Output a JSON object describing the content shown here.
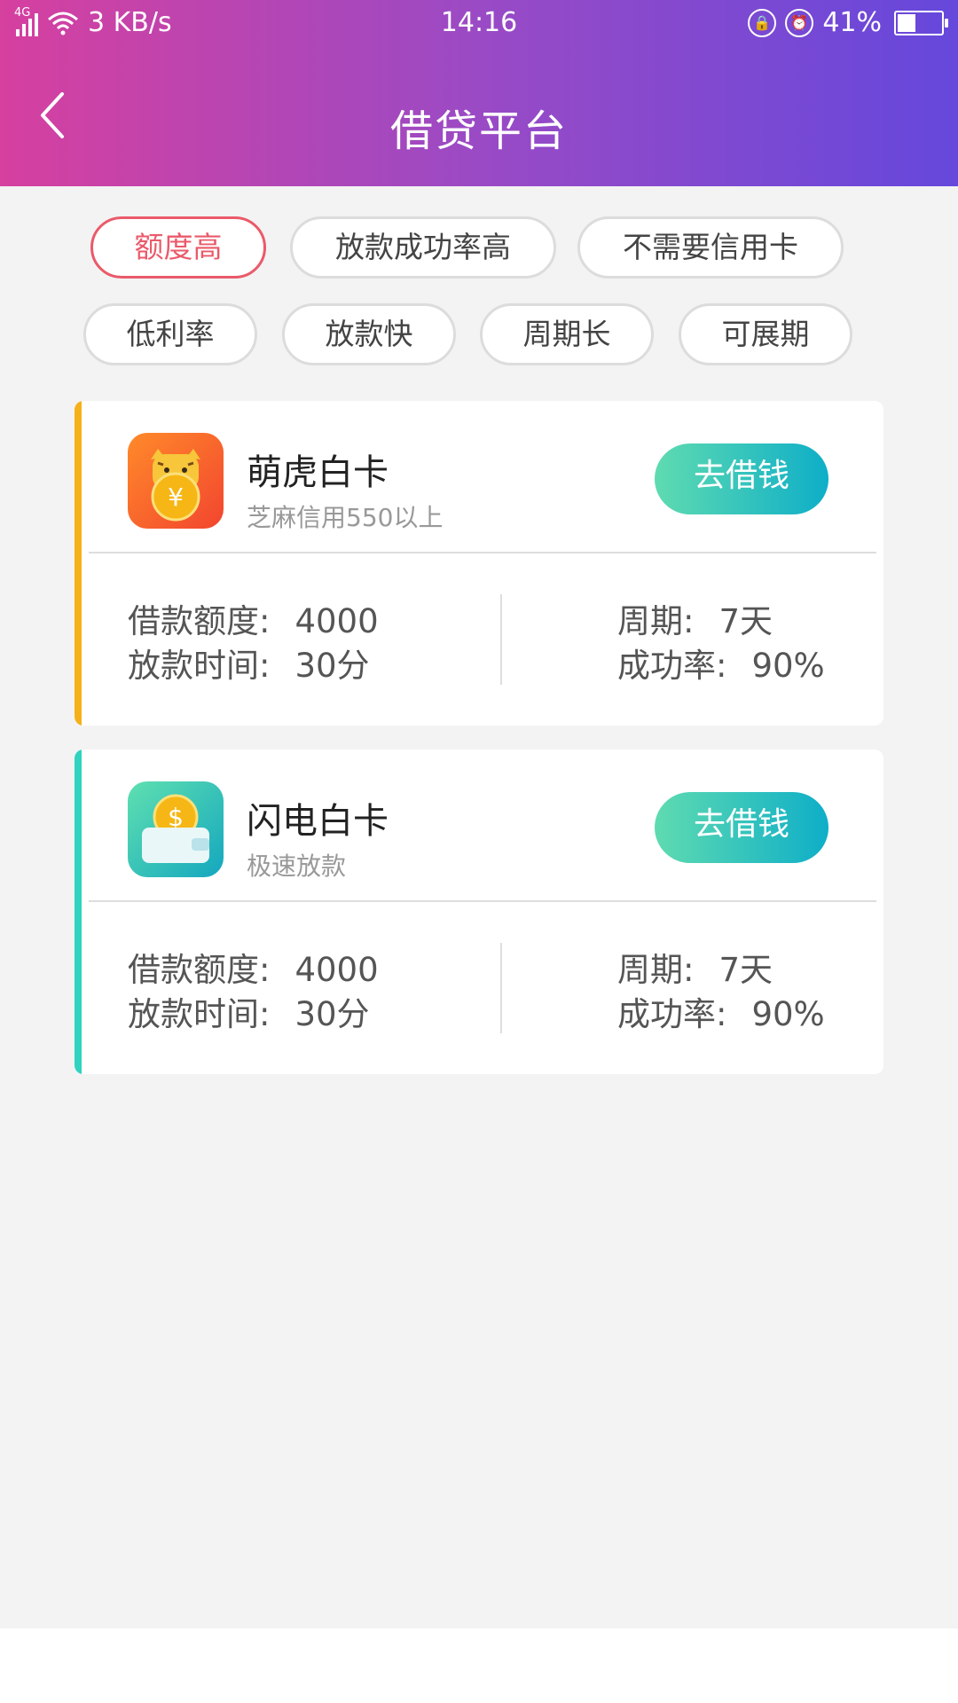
{
  "status_bar": {
    "network": "4G",
    "speed": "3 KB/s",
    "time": "14:16",
    "battery": "41%",
    "battery_level": 0.41,
    "icons": [
      "signal-icon",
      "wifi-icon",
      "rotation-lock-icon",
      "alarm-icon",
      "battery-icon"
    ]
  },
  "header": {
    "title": "借贷平台"
  },
  "filters": [
    {
      "label": "额度高",
      "active": true
    },
    {
      "label": "放款成功率高",
      "active": false
    },
    {
      "label": "不需要信用卡",
      "active": false
    },
    {
      "label": "低利率",
      "active": false
    },
    {
      "label": "放款快",
      "active": false
    },
    {
      "label": "周期长",
      "active": false
    },
    {
      "label": "可展期",
      "active": false
    }
  ],
  "products": [
    {
      "name": "萌虎白卡",
      "subtitle": "芝麻信用550以上",
      "button": "去借钱",
      "accent": "#f5b11a",
      "logo": "tiger-coin-icon",
      "amount_label": "借款额度:",
      "amount": "4000",
      "time_label": "放款时间:",
      "time": "30分",
      "period_label": "周期:",
      "period": "7天",
      "rate_label": "成功率:",
      "rate": "90%"
    },
    {
      "name": "闪电白卡",
      "subtitle": "极速放款",
      "button": "去借钱",
      "accent": "#2fd3c0",
      "logo": "wallet-coin-icon",
      "amount_label": "借款额度:",
      "amount": "4000",
      "time_label": "放款时间:",
      "time": "30分",
      "period_label": "周期:",
      "period": "7天",
      "rate_label": "成功率:",
      "rate": "90%"
    }
  ],
  "colors": {
    "header_gradient": [
      "#d6409f",
      "#6548dc"
    ],
    "active_chip": "#ea5a6a",
    "button_gradient": [
      "#5fdbb0",
      "#0eaec8"
    ]
  }
}
